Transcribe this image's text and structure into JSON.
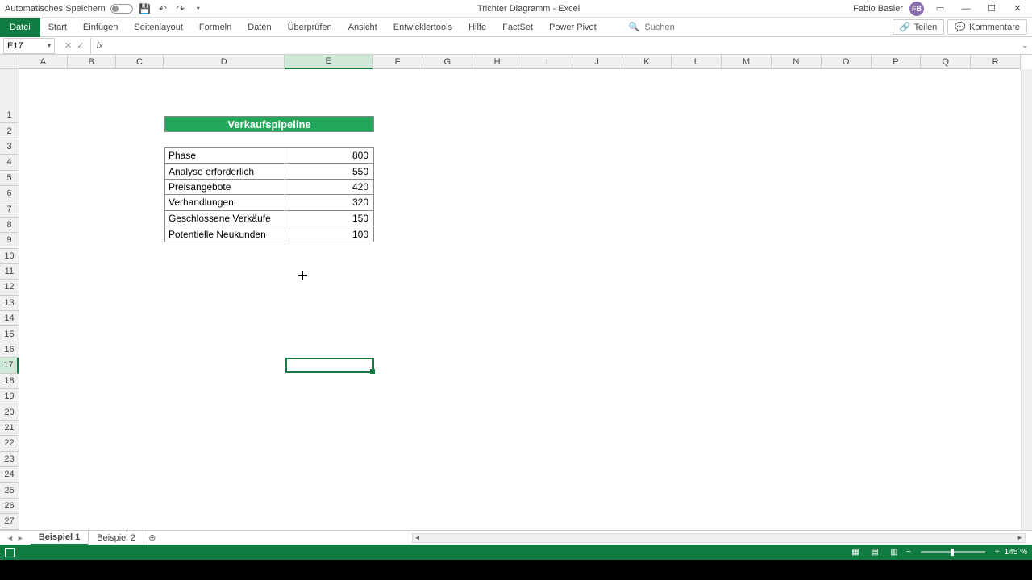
{
  "titlebar": {
    "autosave_label": "Automatisches Speichern",
    "doc_title": "Trichter Diagramm - Excel",
    "user_name": "Fabio Basler",
    "user_initials": "FB"
  },
  "ribbon": {
    "file": "Datei",
    "tabs": [
      "Start",
      "Einfügen",
      "Seitenlayout",
      "Formeln",
      "Daten",
      "Überprüfen",
      "Ansicht",
      "Entwicklertools",
      "Hilfe",
      "FactSet",
      "Power Pivot"
    ],
    "search_placeholder": "Suchen",
    "share": "Teilen",
    "comments": "Kommentare"
  },
  "namebox": "E17",
  "columns": [
    "A",
    "B",
    "C",
    "D",
    "E",
    "F",
    "G",
    "H",
    "I",
    "J",
    "K",
    "L",
    "M",
    "N",
    "O",
    "P",
    "Q",
    "R"
  ],
  "rows_blank_first": true,
  "row_count": 27,
  "selected_col": "E",
  "selected_row": 17,
  "sheet": {
    "header": "Verkaufspipeline",
    "data": [
      {
        "label": "Phase",
        "value": "800"
      },
      {
        "label": "Analyse erforderlich",
        "value": "550"
      },
      {
        "label": "Preisangebote",
        "value": "420"
      },
      {
        "label": "Verhandlungen",
        "value": "320"
      },
      {
        "label": "Geschlossene Verkäufe",
        "value": "150"
      },
      {
        "label": "Potentielle Neukunden",
        "value": "100"
      }
    ]
  },
  "tabs": {
    "items": [
      "Beispiel 1",
      "Beispiel 2"
    ],
    "active": 0
  },
  "status": {
    "zoom": "145 %"
  }
}
